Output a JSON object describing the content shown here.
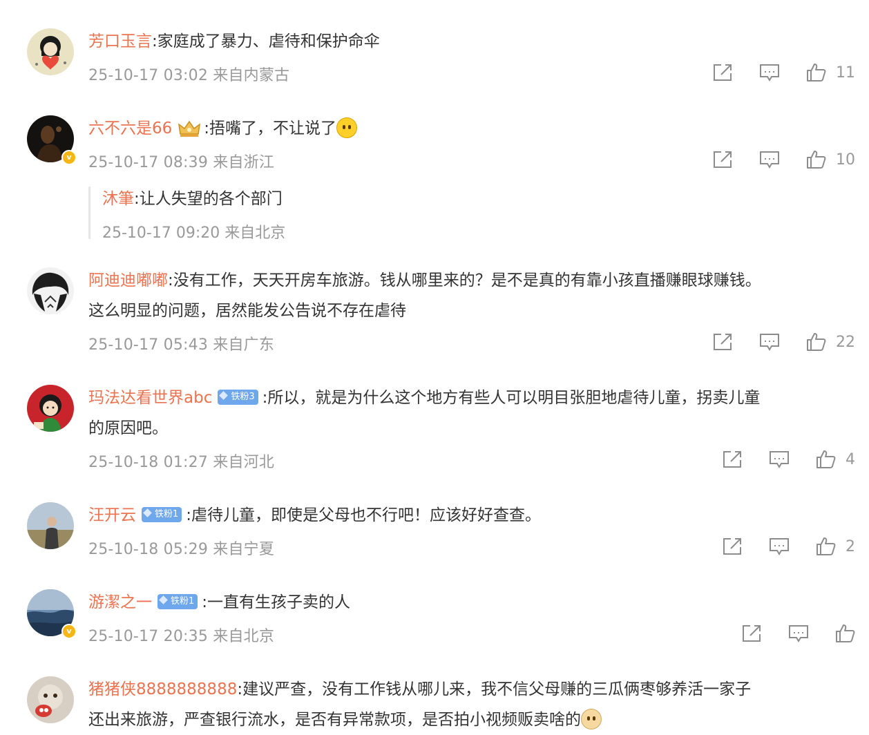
{
  "comments": [
    {
      "user": "芳口玉言",
      "content": ":家庭成了暴力、虐待和保护命伞",
      "time_location": "25-10-17 03:02 来自内蒙古",
      "likes": "11"
    },
    {
      "user": "六不六是66",
      "content": ":捂嘴了，不让说了",
      "time_location": "25-10-17 08:39 来自浙江",
      "likes": "10",
      "reply": {
        "user": "沐筆",
        "content": ":让人失望的各个部门",
        "time_location": "25-10-17 09:20 来自北京"
      }
    },
    {
      "user": "阿迪迪嘟嘟",
      "content_line1": ":没有工作，天天开房车旅游。钱从哪里来的？是不是真的有靠小孩直播赚眼球赚钱。",
      "content_line2": "这么明显的问题，居然能发公告说不存在虐待",
      "time_location": "25-10-17 05:43 来自广东",
      "likes": "22"
    },
    {
      "user": "玛法达看世界abc",
      "fan_badge": "铁粉3",
      "content_line1": ":所以，就是为什么这个地方有些人可以明目张胆地虐待儿童，拐卖儿童",
      "content_line2": "的原因吧。",
      "time_location": "25-10-18 01:27 来自河北",
      "likes": "4"
    },
    {
      "user": "汪开云",
      "fan_badge": "铁粉1",
      "content": ":虐待儿童，即使是父母也不行吧！应该好好查查。",
      "time_location": "25-10-18 05:29 来自宁夏",
      "likes": "2"
    },
    {
      "user": "游潔之一",
      "fan_badge": "铁粉1",
      "content": ":一直有生孩子卖的人",
      "time_location": "25-10-17 20:35 来自北京",
      "likes": ""
    },
    {
      "user": "猪猪侠8888888888",
      "content_line1": ":建议严查，没有工作钱从哪儿来，我不信父母赚的三瓜俩枣够养活一家子",
      "content_line2": "还出来旅游，严查银行流水，是否有异常款项，是否拍小视频贩卖啥的"
    }
  ],
  "icons": {
    "verified_badge": "v",
    "share": "share-icon",
    "comment": "comment-icon",
    "like": "like-icon",
    "member_crown": "crown-icon",
    "emoji": "smile-emoji-icon"
  },
  "colors": {
    "username": "#eb7350",
    "meta": "#999999",
    "text": "#333333",
    "fan_badge": "#6fa7ec"
  }
}
